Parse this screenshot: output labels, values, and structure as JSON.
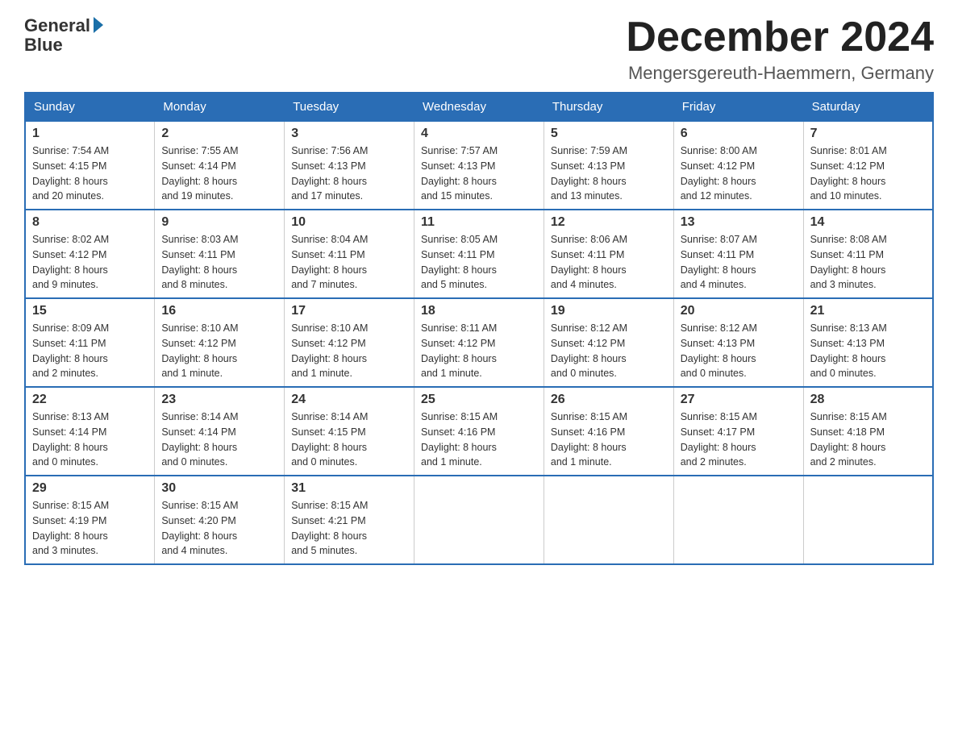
{
  "header": {
    "logo_line1": "General",
    "logo_line2": "Blue",
    "month_year": "December 2024",
    "location": "Mengersgereuth-Haemmern, Germany"
  },
  "weekdays": [
    "Sunday",
    "Monday",
    "Tuesday",
    "Wednesday",
    "Thursday",
    "Friday",
    "Saturday"
  ],
  "weeks": [
    [
      {
        "day": "1",
        "sunrise": "7:54 AM",
        "sunset": "4:15 PM",
        "daylight": "8 hours and 20 minutes."
      },
      {
        "day": "2",
        "sunrise": "7:55 AM",
        "sunset": "4:14 PM",
        "daylight": "8 hours and 19 minutes."
      },
      {
        "day": "3",
        "sunrise": "7:56 AM",
        "sunset": "4:13 PM",
        "daylight": "8 hours and 17 minutes."
      },
      {
        "day": "4",
        "sunrise": "7:57 AM",
        "sunset": "4:13 PM",
        "daylight": "8 hours and 15 minutes."
      },
      {
        "day": "5",
        "sunrise": "7:59 AM",
        "sunset": "4:13 PM",
        "daylight": "8 hours and 13 minutes."
      },
      {
        "day": "6",
        "sunrise": "8:00 AM",
        "sunset": "4:12 PM",
        "daylight": "8 hours and 12 minutes."
      },
      {
        "day": "7",
        "sunrise": "8:01 AM",
        "sunset": "4:12 PM",
        "daylight": "8 hours and 10 minutes."
      }
    ],
    [
      {
        "day": "8",
        "sunrise": "8:02 AM",
        "sunset": "4:12 PM",
        "daylight": "8 hours and 9 minutes."
      },
      {
        "day": "9",
        "sunrise": "8:03 AM",
        "sunset": "4:11 PM",
        "daylight": "8 hours and 8 minutes."
      },
      {
        "day": "10",
        "sunrise": "8:04 AM",
        "sunset": "4:11 PM",
        "daylight": "8 hours and 7 minutes."
      },
      {
        "day": "11",
        "sunrise": "8:05 AM",
        "sunset": "4:11 PM",
        "daylight": "8 hours and 5 minutes."
      },
      {
        "day": "12",
        "sunrise": "8:06 AM",
        "sunset": "4:11 PM",
        "daylight": "8 hours and 4 minutes."
      },
      {
        "day": "13",
        "sunrise": "8:07 AM",
        "sunset": "4:11 PM",
        "daylight": "8 hours and 4 minutes."
      },
      {
        "day": "14",
        "sunrise": "8:08 AM",
        "sunset": "4:11 PM",
        "daylight": "8 hours and 3 minutes."
      }
    ],
    [
      {
        "day": "15",
        "sunrise": "8:09 AM",
        "sunset": "4:11 PM",
        "daylight": "8 hours and 2 minutes."
      },
      {
        "day": "16",
        "sunrise": "8:10 AM",
        "sunset": "4:12 PM",
        "daylight": "8 hours and 1 minute."
      },
      {
        "day": "17",
        "sunrise": "8:10 AM",
        "sunset": "4:12 PM",
        "daylight": "8 hours and 1 minute."
      },
      {
        "day": "18",
        "sunrise": "8:11 AM",
        "sunset": "4:12 PM",
        "daylight": "8 hours and 1 minute."
      },
      {
        "day": "19",
        "sunrise": "8:12 AM",
        "sunset": "4:12 PM",
        "daylight": "8 hours and 0 minutes."
      },
      {
        "day": "20",
        "sunrise": "8:12 AM",
        "sunset": "4:13 PM",
        "daylight": "8 hours and 0 minutes."
      },
      {
        "day": "21",
        "sunrise": "8:13 AM",
        "sunset": "4:13 PM",
        "daylight": "8 hours and 0 minutes."
      }
    ],
    [
      {
        "day": "22",
        "sunrise": "8:13 AM",
        "sunset": "4:14 PM",
        "daylight": "8 hours and 0 minutes."
      },
      {
        "day": "23",
        "sunrise": "8:14 AM",
        "sunset": "4:14 PM",
        "daylight": "8 hours and 0 minutes."
      },
      {
        "day": "24",
        "sunrise": "8:14 AM",
        "sunset": "4:15 PM",
        "daylight": "8 hours and 0 minutes."
      },
      {
        "day": "25",
        "sunrise": "8:15 AM",
        "sunset": "4:16 PM",
        "daylight": "8 hours and 1 minute."
      },
      {
        "day": "26",
        "sunrise": "8:15 AM",
        "sunset": "4:16 PM",
        "daylight": "8 hours and 1 minute."
      },
      {
        "day": "27",
        "sunrise": "8:15 AM",
        "sunset": "4:17 PM",
        "daylight": "8 hours and 2 minutes."
      },
      {
        "day": "28",
        "sunrise": "8:15 AM",
        "sunset": "4:18 PM",
        "daylight": "8 hours and 2 minutes."
      }
    ],
    [
      {
        "day": "29",
        "sunrise": "8:15 AM",
        "sunset": "4:19 PM",
        "daylight": "8 hours and 3 minutes."
      },
      {
        "day": "30",
        "sunrise": "8:15 AM",
        "sunset": "4:20 PM",
        "daylight": "8 hours and 4 minutes."
      },
      {
        "day": "31",
        "sunrise": "8:15 AM",
        "sunset": "4:21 PM",
        "daylight": "8 hours and 5 minutes."
      },
      null,
      null,
      null,
      null
    ]
  ],
  "labels": {
    "sunrise": "Sunrise:",
    "sunset": "Sunset:",
    "daylight": "Daylight:"
  }
}
